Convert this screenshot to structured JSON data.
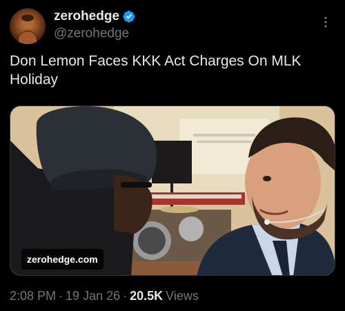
{
  "author": {
    "display_name": "zerohedge",
    "handle": "@zerohedge",
    "verified": true,
    "verified_color": "#1d9bf0"
  },
  "tweet": {
    "text": "Don Lemon Faces KKK Act Charges On MLK Holiday"
  },
  "media": {
    "badge": "zerohedge.com"
  },
  "meta": {
    "time": "2:08 PM",
    "separator": "·",
    "date": "19 Jan 26",
    "views_count": "20.5K",
    "views_label": "Views"
  },
  "icons": {
    "more": "more-options-icon",
    "verified": "verified-badge-icon"
  },
  "colors": {
    "background": "#000000",
    "text_primary": "#e7e9ea",
    "text_secondary": "#71767b"
  }
}
